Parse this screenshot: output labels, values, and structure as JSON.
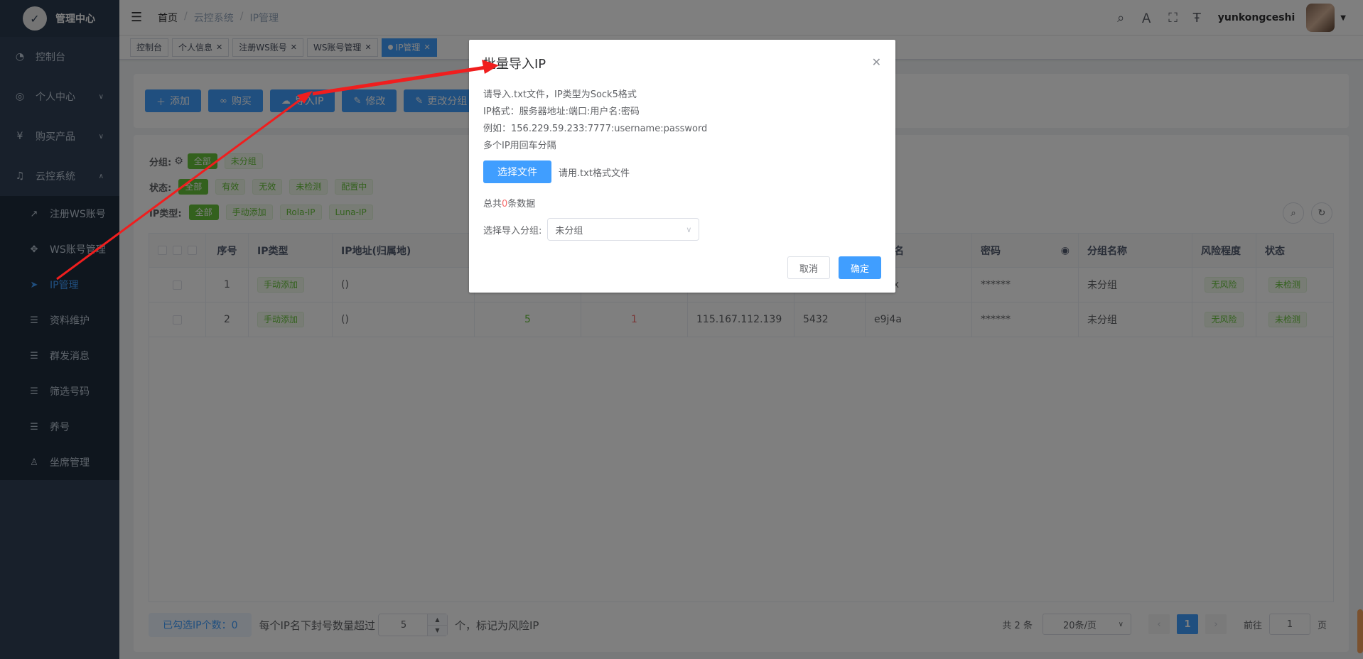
{
  "sidebar": {
    "brand": "管理中心",
    "menu": [
      {
        "label": "控制台",
        "icon": "dashboard-icon"
      },
      {
        "label": "个人中心",
        "icon": "user-circle-icon"
      },
      {
        "label": "购买产品",
        "icon": "yen-icon"
      },
      {
        "label": "云控系统",
        "icon": "headset-icon"
      }
    ],
    "submenu": [
      {
        "label": "注册WS账号"
      },
      {
        "label": "WS账号管理"
      },
      {
        "label": "IP管理"
      },
      {
        "label": "资料维护"
      },
      {
        "label": "群发消息"
      },
      {
        "label": "筛选号码"
      },
      {
        "label": "养号"
      },
      {
        "label": "坐席管理"
      }
    ]
  },
  "header": {
    "breadcrumb": [
      "首页",
      "云控系统",
      "IP管理"
    ],
    "username": "yunkongceshi"
  },
  "tags": [
    "控制台",
    "个人信息",
    "注册WS账号",
    "WS账号管理",
    "IP管理"
  ],
  "toolbar": {
    "add": "添加",
    "buy": "购买",
    "import": "导入IP",
    "edit": "修改",
    "change_group": "更改分组"
  },
  "filters": {
    "group_label": "分组:",
    "group_opts": [
      "全部",
      "未分组"
    ],
    "status_label": "状态:",
    "status_opts": [
      "全部",
      "有效",
      "无效",
      "未检测",
      "配置中"
    ],
    "type_label": "IP类型:",
    "type_opts": [
      "全部",
      "手动添加",
      "Rola-IP",
      "Luna-IP"
    ]
  },
  "table": {
    "headers": {
      "seq": "序号",
      "type": "IP类型",
      "addr": "IP地址(归属地)",
      "user": "用户名",
      "pwd": "密码",
      "group": "分组名称",
      "risk": "风险程度",
      "status": "状态"
    },
    "rows": [
      {
        "seq": "1",
        "type": "手动添加",
        "addr": "()",
        "n1": "",
        "n2": "",
        "ip": "",
        "port": "",
        "user": "545x",
        "pwd": "******",
        "group": "未分组",
        "risk": "无风险",
        "status": "未检测"
      },
      {
        "seq": "2",
        "type": "手动添加",
        "addr": "()",
        "n1": "5",
        "n2": "1",
        "ip": "115.167.112.139",
        "port": "5432",
        "user": "e9j4a",
        "pwd": "******",
        "group": "未分组",
        "risk": "无风险",
        "status": "未检测"
      }
    ]
  },
  "footer": {
    "selected": "已勾选IP个数：0",
    "text1": "每个IP名下封号数量超过",
    "threshold": "5",
    "text2": "个，标记为风险IP",
    "total": "共 2 条",
    "page_size": "20条/页",
    "current_page": "1",
    "goto_label": "前往",
    "goto_value": "1",
    "page_suffix": "页"
  },
  "dialog": {
    "title": "批量导入IP",
    "line1": "请导入.txt文件，IP类型为Sock5格式",
    "line2": "IP格式：服务器地址:端口:用户名:密码",
    "line3": "例如：156.229.59.233:7777:username:password",
    "line4": "多个IP用回车分隔",
    "choose_file": "选择文件",
    "file_tip": "请用.txt格式文件",
    "total_prefix": "总共",
    "total_count": "0",
    "total_suffix": "条数据",
    "group_label": "选择导入分组:",
    "group_value": "未分组",
    "cancel": "取消",
    "confirm": "确定"
  },
  "colors": {
    "primary": "#409eff",
    "sidebar_bg": "#304156",
    "success": "#67c23a",
    "danger": "#f56c6c",
    "annotation": "#f01e1e"
  }
}
